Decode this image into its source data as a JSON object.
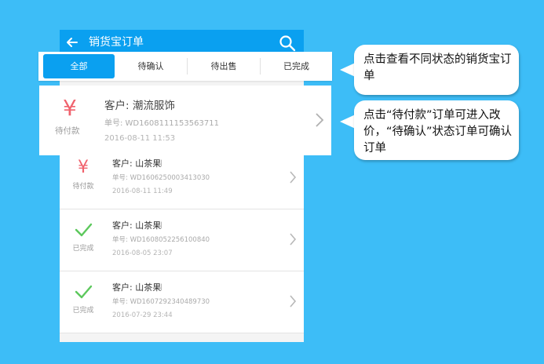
{
  "appbar": {
    "title": "销货宝订单",
    "back_icon": "back-arrow-icon",
    "search_icon": "search-icon"
  },
  "tabs": [
    {
      "label": "全部",
      "active": true
    },
    {
      "label": "待确认",
      "active": false
    },
    {
      "label": "待出售",
      "active": false
    },
    {
      "label": "已完成",
      "active": false
    }
  ],
  "highlighted_order": {
    "status_icon": "yen-icon",
    "status": "待付款",
    "customer": "客户: 潮流服饰",
    "order_no": "单号: WD1608111153563711",
    "date": "2016-08-11 11:53"
  },
  "orders": [
    {
      "status_icon": "yen-icon",
      "status": "待付款",
      "customer": "客户: 山茶果𝄀",
      "order_no": "单号: WD1606250003413030",
      "date": "2016-08-11 11:49"
    },
    {
      "status_icon": "check-icon",
      "status": "已完成",
      "customer": "客户: 山茶果𝄀",
      "order_no": "单号: WD1608052256100840",
      "date": "2016-08-05 23:07"
    },
    {
      "status_icon": "check-icon",
      "status": "已完成",
      "customer": "客户: 山茶果𝄀",
      "order_no": "单号: WD1607292340489730",
      "date": "2016-07-29 23:44"
    }
  ],
  "callouts": [
    {
      "text": "点击查看不同状态的销货宝订单"
    },
    {
      "text": "点击“待付款”订单可进入改价，“待确认”状态订单可确认订单"
    }
  ],
  "colors": {
    "background": "#3dbdf7",
    "accent": "#0aa0f0",
    "yen": "#f0626d",
    "check": "#5cc85c"
  }
}
